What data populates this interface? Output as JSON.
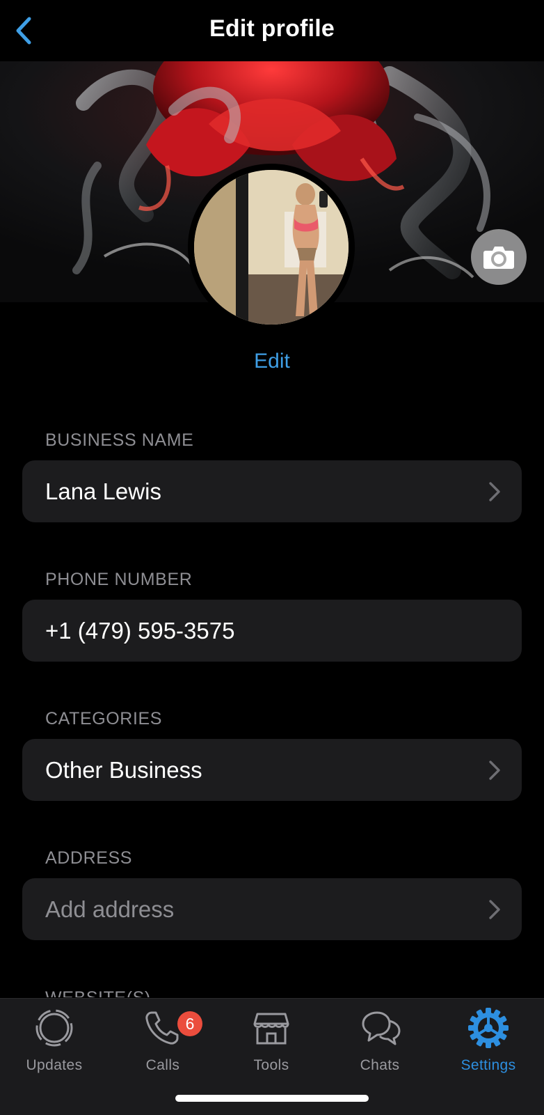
{
  "nav": {
    "title": "Edit profile",
    "back_icon": "chevron-left-icon",
    "accent_color": "#3f9fe6"
  },
  "profile": {
    "edit_label": "Edit",
    "cover_camera_icon": "camera-icon"
  },
  "fields": [
    {
      "label": "BUSINESS NAME",
      "value": "Lana Lewis",
      "has_chevron": true
    },
    {
      "label": "PHONE NUMBER",
      "value": "+1 (479) 595-3575",
      "has_chevron": false
    },
    {
      "label": "CATEGORIES",
      "value": "Other Business",
      "has_chevron": true
    },
    {
      "label": "ADDRESS",
      "value": "",
      "placeholder": "Add address",
      "has_chevron": true
    }
  ],
  "partial_label": "WEBSITE(S)",
  "tabs": [
    {
      "label": "Updates",
      "icon": "updates-icon",
      "active": false
    },
    {
      "label": "Calls",
      "icon": "phone-icon",
      "active": false,
      "badge": "6"
    },
    {
      "label": "Tools",
      "icon": "storefront-icon",
      "active": false
    },
    {
      "label": "Chats",
      "icon": "chat-bubbles-icon",
      "active": false
    },
    {
      "label": "Settings",
      "icon": "gear-icon",
      "active": true
    }
  ],
  "colors": {
    "background": "#000000",
    "field_bg": "#1c1c1e",
    "label_gray": "#8e8e93",
    "active_tab": "#2d8fe0",
    "badge_red": "#eb4d3d"
  }
}
